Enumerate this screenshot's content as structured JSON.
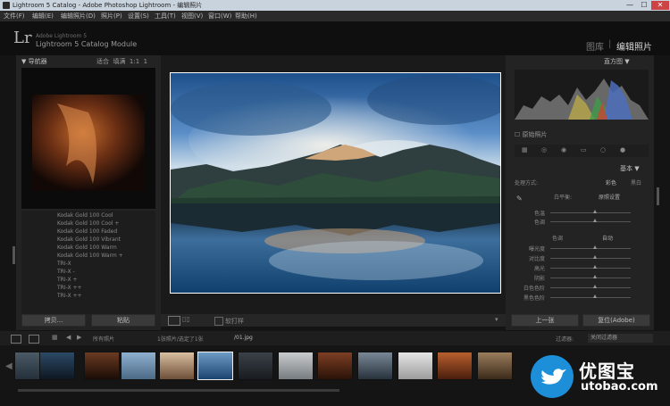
{
  "window": {
    "title": "Lightroom 5 Catalog - Adobe Photoshop Lightroom - 编辑照片",
    "minimize": "—",
    "maximize": "☐",
    "close": "✕"
  },
  "menu": [
    "文件(F)",
    "编辑(E)",
    "编辑照片(D)",
    "照片(P)",
    "设置(S)",
    "工具(T)",
    "视图(V)",
    "窗口(W)",
    "帮助(H)"
  ],
  "identity": {
    "logo": "Lr",
    "line1": "Adobe Lightroom 5",
    "line2": "Lightroom 5 Catalog Module",
    "modules": [
      "图库",
      "编辑照片"
    ],
    "active_module": "编辑照片"
  },
  "left_panel": {
    "navigator_label": "导航器",
    "zoom_options": [
      "适合",
      "填满",
      "1:1",
      "1"
    ],
    "presets": [
      "Kodak Gold 100 Cool",
      "Kodak Gold 100 Cool +",
      "Kodak Gold 100 Faded",
      "Kodak Gold 100 Vibrant",
      "Kodak Gold 100 Warm",
      "Kodak Gold 100 Warm +",
      "TRI-X",
      "TRI-X -",
      "TRI-X +",
      "TRI-X ++",
      "TRI-X ++"
    ],
    "copy_button": "拷贝...",
    "paste_button": "粘贴"
  },
  "toolbar": {
    "softproof": "软打样"
  },
  "right_panel": {
    "histogram_label": "直方图",
    "original_label": "原始照片",
    "basic_label": "基本",
    "treatment_label": "处理方式:",
    "treatment_options": [
      "彩色",
      "黑白"
    ],
    "wb_label": "白平衡:",
    "wb_value": "原照设置",
    "temp_label": "色温",
    "tint_label": "色调",
    "tone_label": "色调",
    "auto_label": "自动",
    "sliders": [
      "曝光度",
      "对比度",
      "高光",
      "阴影",
      "白色色阶",
      "黑色色阶"
    ],
    "prev_button": "上一张",
    "reset_button": "复位(Adobe)"
  },
  "filmstrip_bar": {
    "label": "所有照片",
    "count": "1张照片/选定了1张",
    "filename": "/01.jpg",
    "filter_label": "过滤器:",
    "filter_value": "关闭过滤器"
  },
  "watermark": {
    "text_cn": "优图宝",
    "text_url": "utobao.com"
  },
  "colors": {
    "accent": "#ffffff",
    "panel_bg": "#232323",
    "brand_blue": "#1c8fd8"
  }
}
